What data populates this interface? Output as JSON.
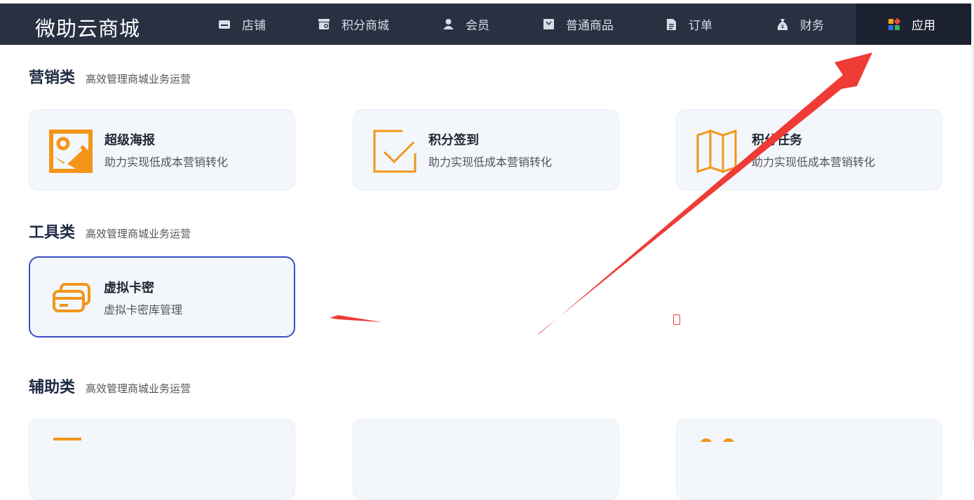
{
  "brand": "微助云商城",
  "nav": [
    {
      "label": "店铺",
      "icon": "store-icon"
    },
    {
      "label": "积分商城",
      "icon": "points-mall-icon"
    },
    {
      "label": "会员",
      "icon": "user-icon"
    },
    {
      "label": "普通商品",
      "icon": "goods-icon"
    },
    {
      "label": "订单",
      "icon": "document-icon"
    },
    {
      "label": "财务",
      "icon": "money-bag-icon"
    },
    {
      "label": "应用",
      "icon": "apps-icon",
      "active": true
    }
  ],
  "sections": {
    "marketing": {
      "title": "营销类",
      "subtitle": "高效管理商城业务运营",
      "cards": [
        {
          "title": "超级海报",
          "desc": "助力实现低成本营销转化",
          "icon": "poster-icon"
        },
        {
          "title": "积分签到",
          "desc": "助力实现低成本营销转化",
          "icon": "checkin-icon"
        },
        {
          "title": "积分任务",
          "desc": "助力实现低成本营销转化",
          "icon": "task-map-icon"
        }
      ]
    },
    "tools": {
      "title": "工具类",
      "subtitle": "高效管理商城业务运营",
      "cards": [
        {
          "title": "虚拟卡密",
          "desc": "虚拟卡密库管理",
          "icon": "virtual-card-icon"
        }
      ]
    },
    "auxiliary": {
      "title": "辅助类",
      "subtitle": "高效管理商城业务运营"
    }
  },
  "colors": {
    "nav_bg": "#283042",
    "nav_active_bg": "#1b2130",
    "icon_orange": "#f29619",
    "card_bg": "#f3f7fc",
    "selected_border": "#3a4fc6",
    "annotation_red": "#ef3b36"
  }
}
